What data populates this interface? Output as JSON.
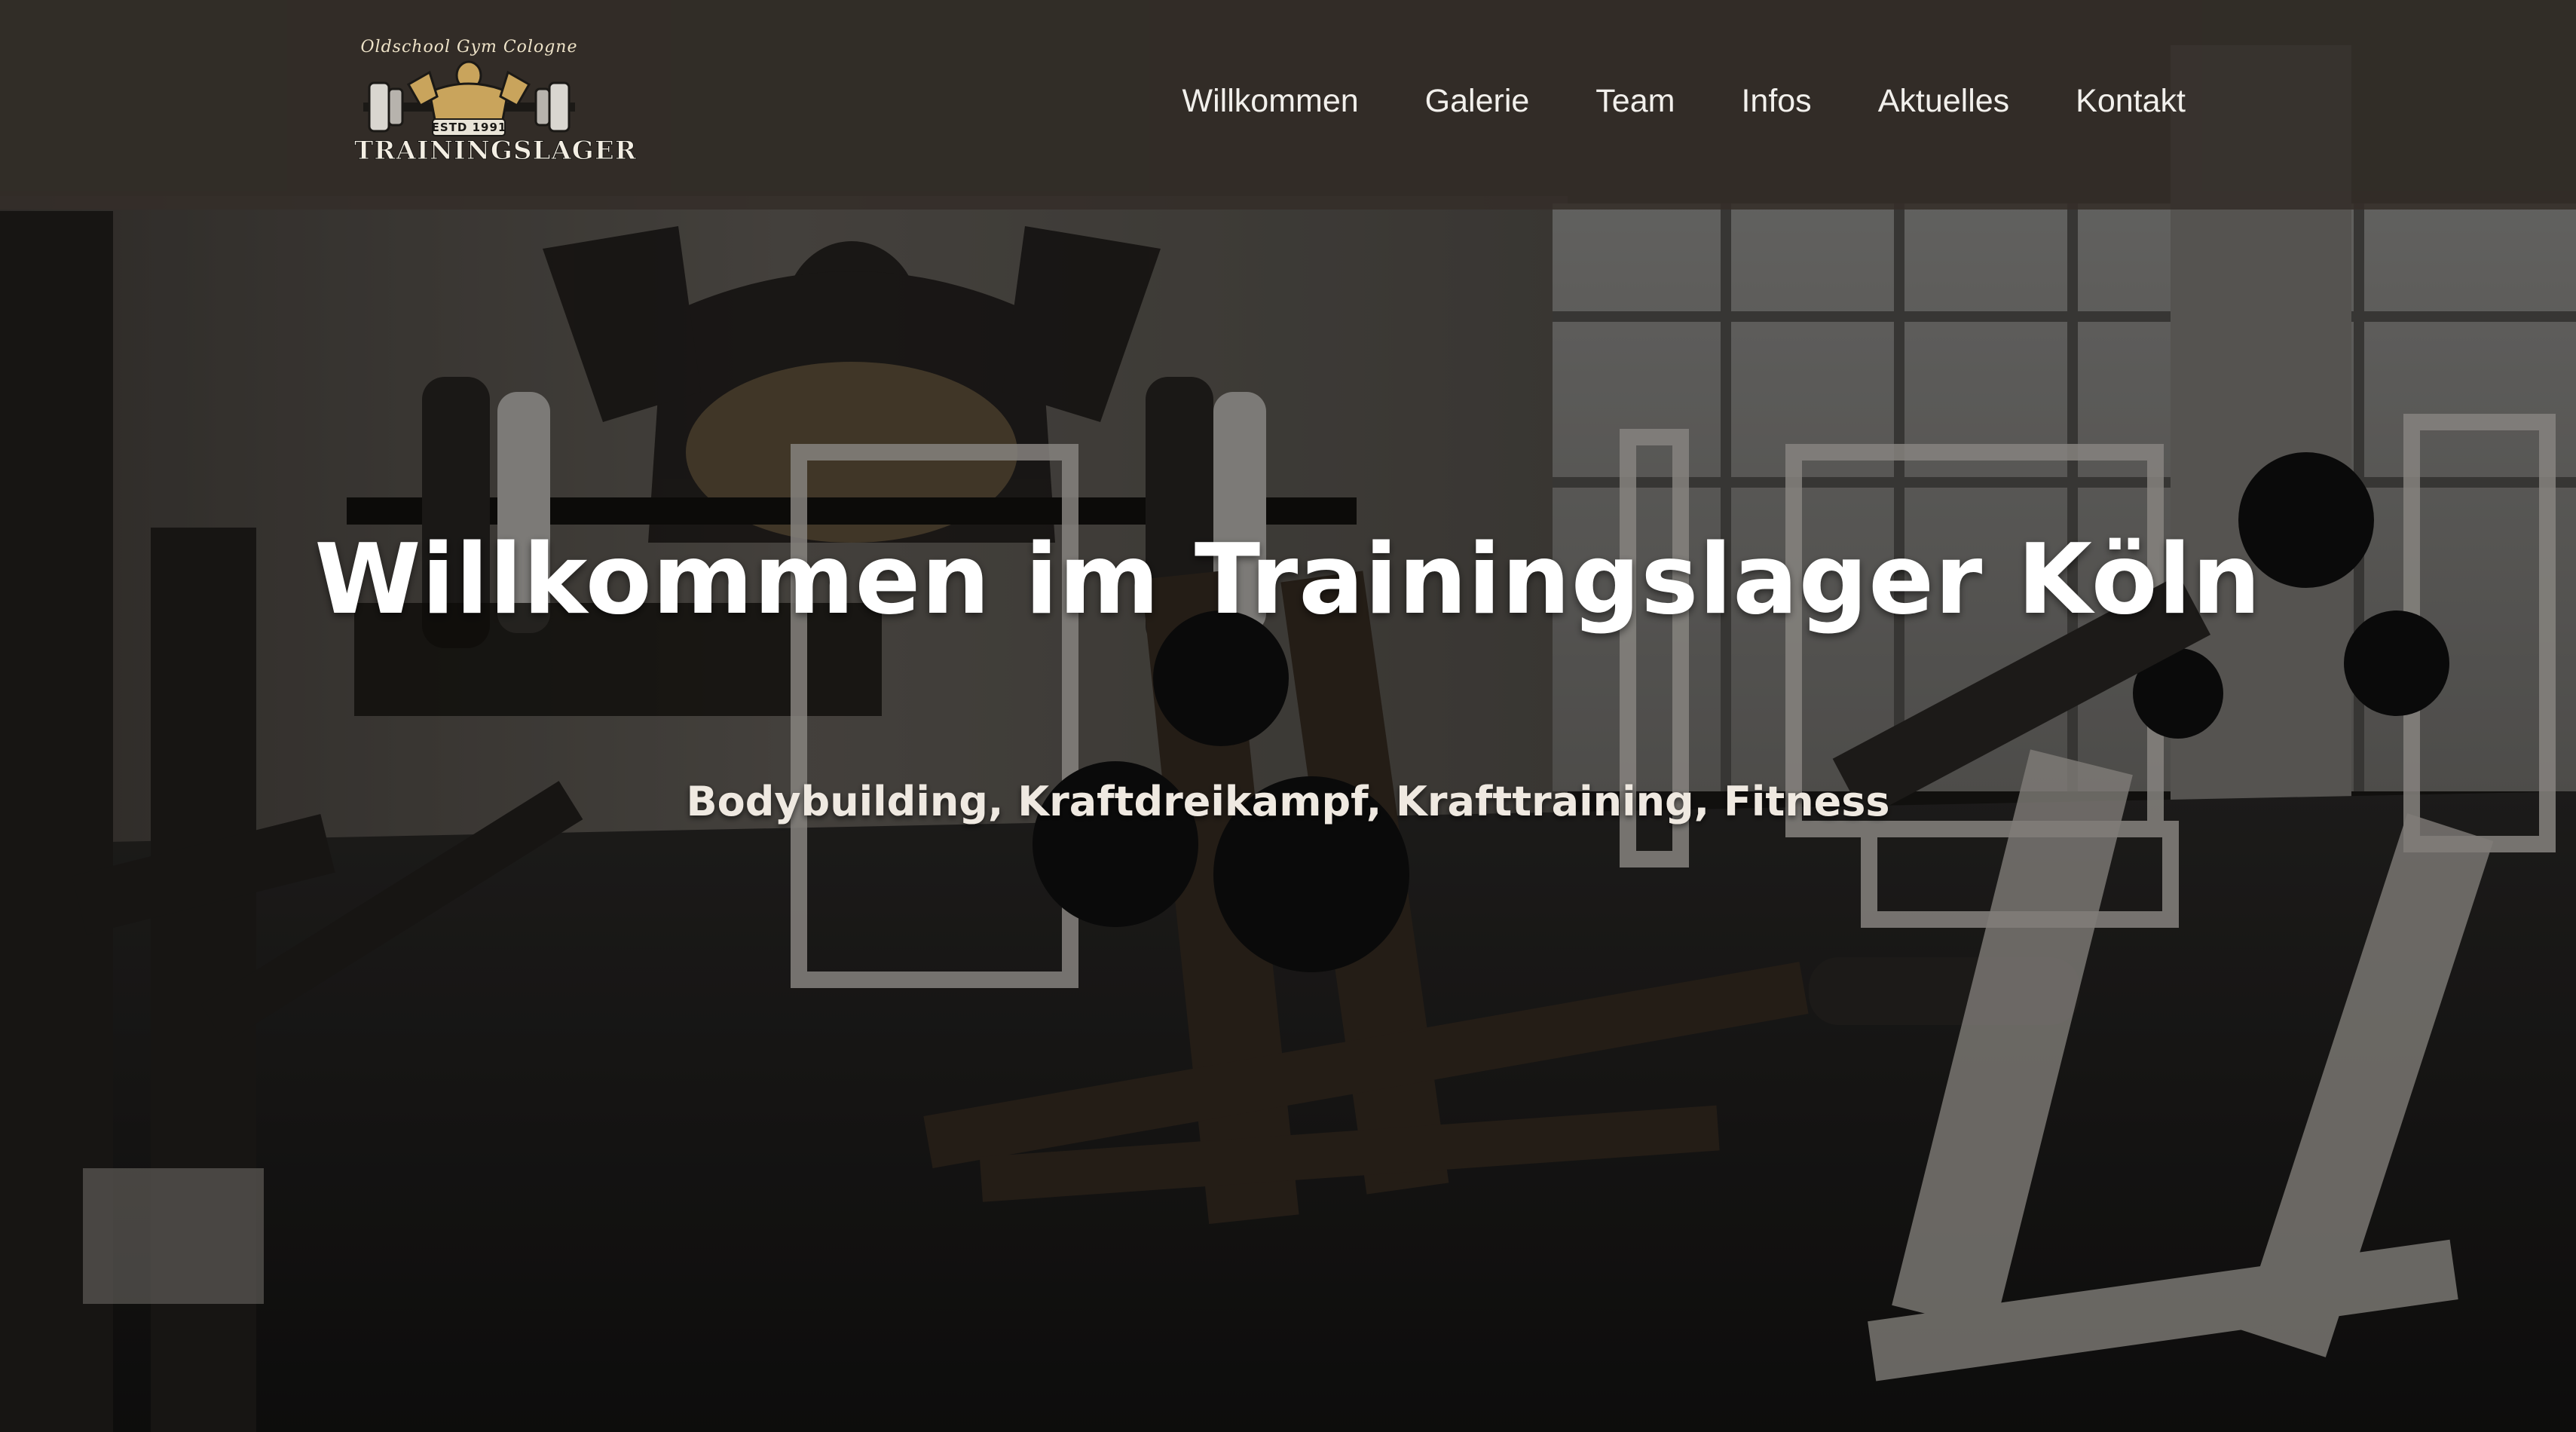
{
  "logo": {
    "top_text": "Oldschool Gym Cologne",
    "est_text": "ESTD 1991",
    "bottom_text": "TRAININGSLAGER"
  },
  "nav": {
    "items": [
      {
        "label": "Willkommen"
      },
      {
        "label": "Galerie"
      },
      {
        "label": "Team"
      },
      {
        "label": "Infos"
      },
      {
        "label": "Aktuelles"
      },
      {
        "label": "Kontakt"
      }
    ]
  },
  "hero": {
    "title": "Willkommen im Trainingslager Köln",
    "subtitle": "Bodybuilding, Kraftdreikampf, Krafttraining, Fitness"
  },
  "colors": {
    "header_bg": "#342e29",
    "text": "#ffffff",
    "logo_gold": "#c9a45c"
  }
}
